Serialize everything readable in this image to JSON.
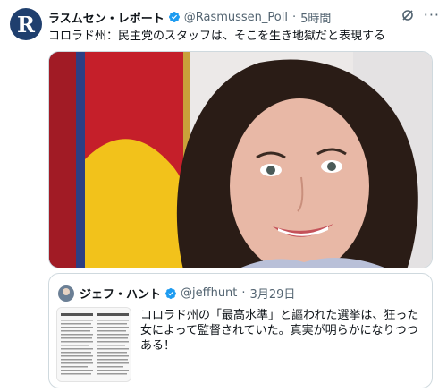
{
  "tweet": {
    "author": {
      "display_name": "ラスムセン・レポート",
      "handle": "@Rasmussen_Poll",
      "avatar_letter": "R",
      "avatar_color": "#1f3f6e"
    },
    "separator": "·",
    "time": "5時間",
    "text": "コロラド州：民主党のスタッフは、そこを生き地獄だと表現する",
    "more_label": "···",
    "media": {
      "type": "photo"
    }
  },
  "quote": {
    "author": {
      "display_name": "ジェフ・ハント",
      "handle": "@jeffhunt"
    },
    "separator": "·",
    "date": "3月29日",
    "text": "コロラド州の「最高水準」と謳われた選挙は、狂った女によって監督されていた。真実が明らかになりつつある！"
  },
  "colors": {
    "verified": "#1d9bf0",
    "secondary_text": "#536471",
    "border": "#cfd9de"
  },
  "icons": [
    "verified-badge-icon",
    "grok-icon",
    "more-icon"
  ]
}
